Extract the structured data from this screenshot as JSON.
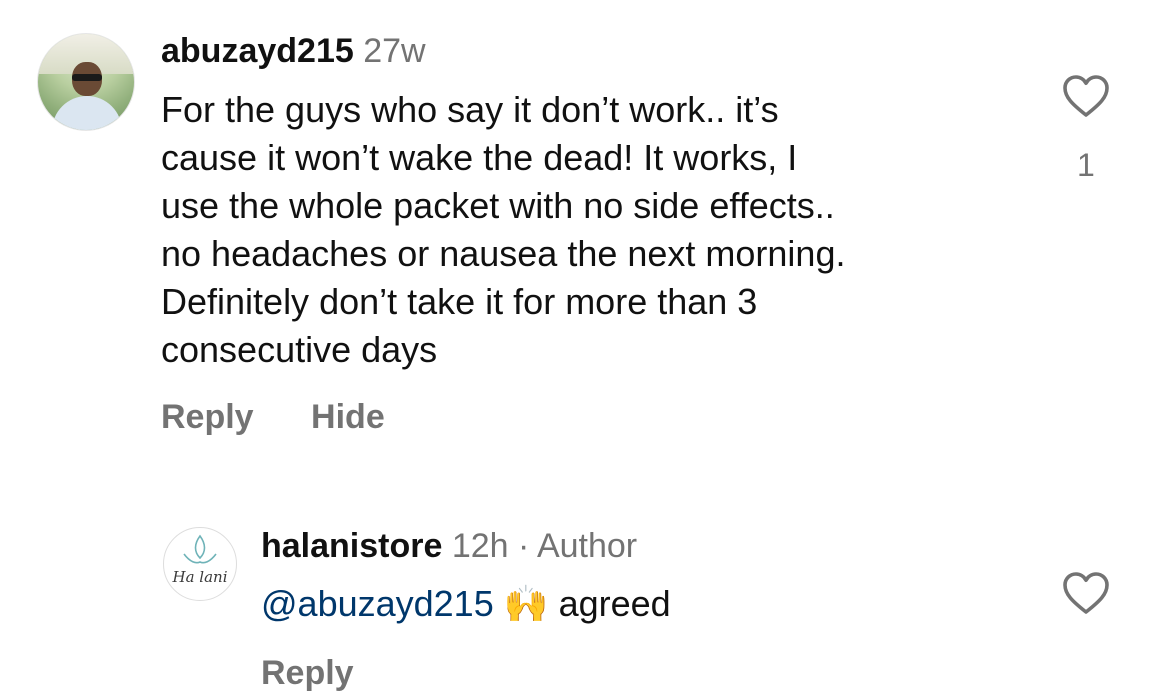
{
  "comments": [
    {
      "username": "abuzayd215",
      "time": "27w",
      "lines": [
        "For the guys who say it don’t work.. it’s",
        "cause it won’t wake the dead! It works, I",
        "use the whole packet with no side effects..",
        "no headaches or nausea the next morning.",
        "Definitely don’t take it for more than 3",
        "consecutive days"
      ],
      "actions": {
        "reply": "Reply",
        "hide": "Hide"
      },
      "like_count": "1",
      "avatar_icon": "profile-photo"
    },
    {
      "username": "halanistore",
      "time": "12h",
      "separator": "·",
      "author_badge": "Author",
      "mention": "@abuzayd215",
      "emoji": "🙌",
      "text": "agreed",
      "actions": {
        "reply": "Reply"
      },
      "avatar_logo_text": "Ha lani",
      "avatar_icon": "halani-lotus-logo"
    }
  ],
  "colors": {
    "username": "#111111",
    "meta": "#737373",
    "mention": "#00376b"
  },
  "icons": {
    "like": "heart-outline-icon"
  }
}
